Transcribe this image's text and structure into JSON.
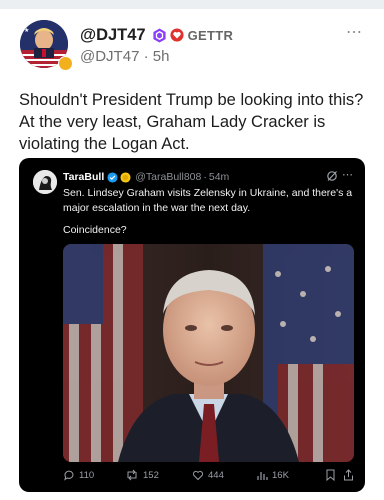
{
  "post": {
    "display_name": "@DJT47",
    "platform": "GETTR",
    "handle": "@DJT47",
    "separator": "·",
    "time": "5h",
    "text": "Shouldn't President Trump be looking into this? At the very least, Graham Lady Cracker is violating the Logan Act.",
    "more_icon": "⋯",
    "icons": [
      "avatar",
      "gold-badge-icon",
      "hexagon-badge-icon",
      "heart-badge-icon",
      "more-icon"
    ]
  },
  "quoted": {
    "name": "TaraBull",
    "handle": "@TaraBull808",
    "separator": "·",
    "time": "54m",
    "text": "Sen. Lindsey Graham visits Zelensky in Ukraine, and there's a major escalation in the war the next day.",
    "text2": "Coincidence?",
    "more_icon": "⋯",
    "photo_description_icon": "photo",
    "actions": {
      "replies": "110",
      "reposts": "152",
      "likes": "444",
      "views": "16K"
    },
    "icons": [
      "verified-icon",
      "coin-icon",
      "grok-icon",
      "reply-icon",
      "repost-icon",
      "like-icon",
      "views-icon",
      "bookmark-icon",
      "share-icon"
    ]
  },
  "colors": {
    "accent_purple": "#8a3ffc",
    "accent_red": "#e0322f",
    "verified_blue": "#1d9bf0",
    "card_bg": "#000000"
  }
}
